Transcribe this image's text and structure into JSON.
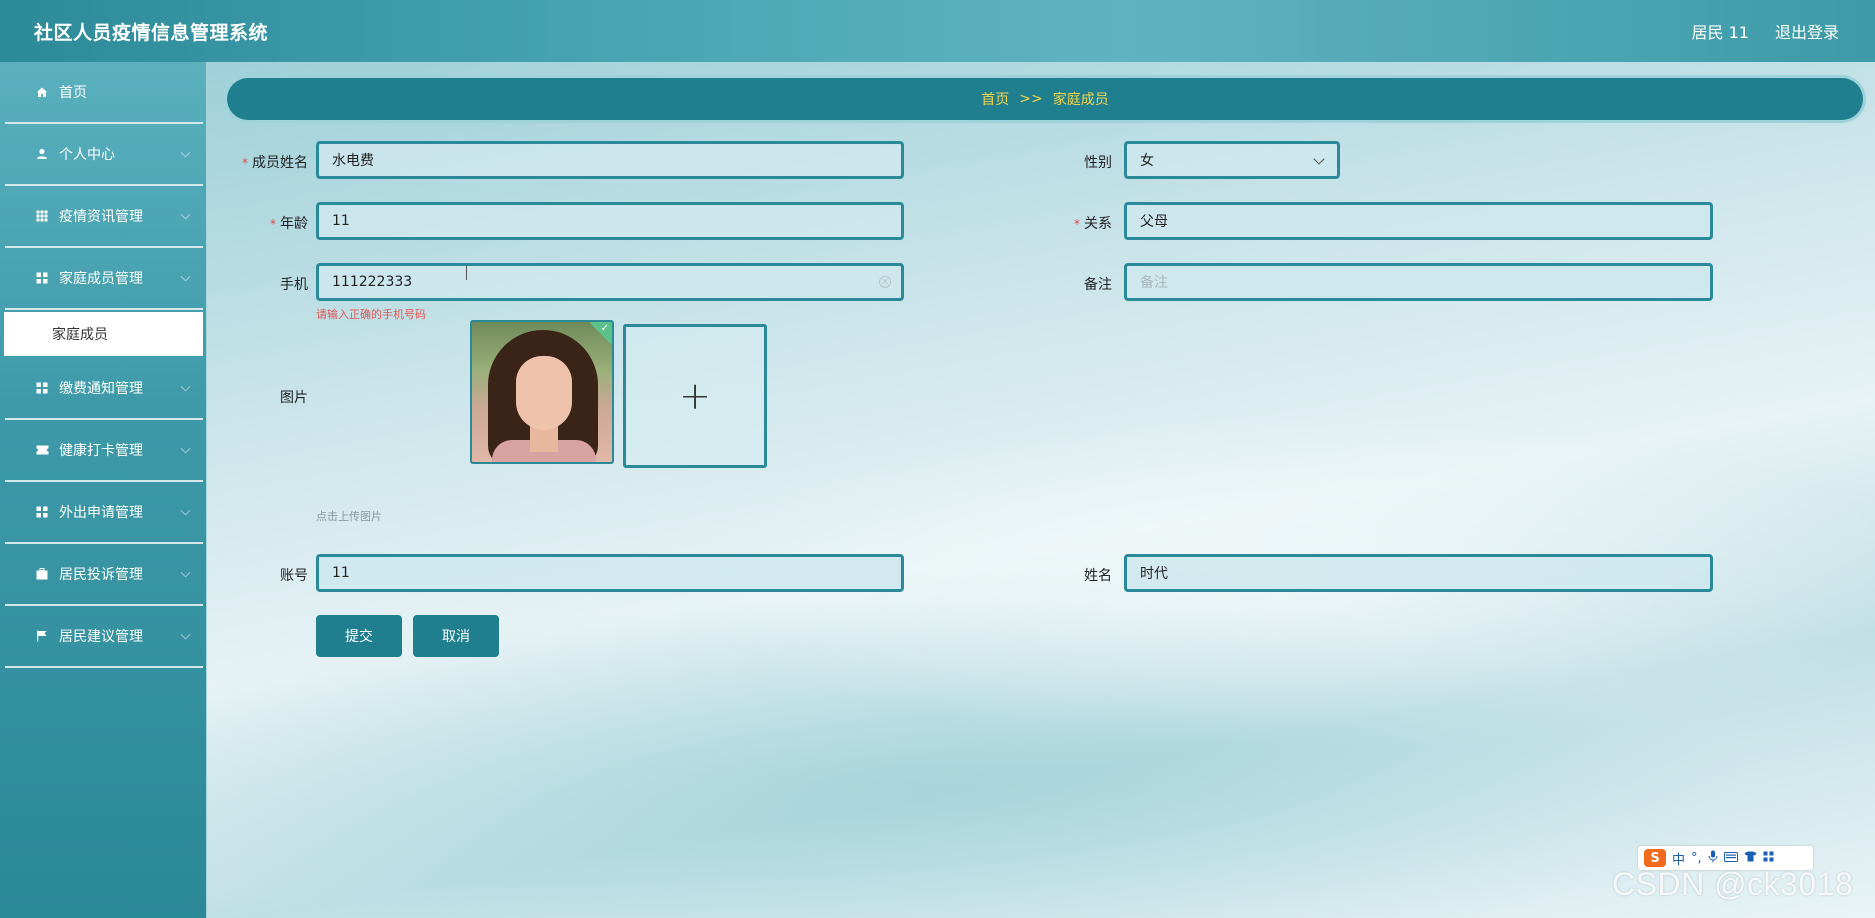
{
  "app": {
    "title": "社区人员疫情信息管理系统",
    "user_label": "居民 11",
    "logout_label": "退出登录"
  },
  "sidebar": {
    "items": [
      {
        "label": "首页",
        "icon": "home-icon"
      },
      {
        "label": "个人中心",
        "icon": "user-icon"
      },
      {
        "label": "疫情资讯管理",
        "icon": "grid-icon"
      },
      {
        "label": "家庭成员管理",
        "icon": "apps-icon"
      },
      {
        "label": "家庭成员",
        "icon": ""
      },
      {
        "label": "缴费通知管理",
        "icon": "apps-icon"
      },
      {
        "label": "健康打卡管理",
        "icon": "ticket-icon"
      },
      {
        "label": "外出申请管理",
        "icon": "apps-icon"
      },
      {
        "label": "居民投诉管理",
        "icon": "briefcase-icon"
      },
      {
        "label": "居民建议管理",
        "icon": "flag-icon"
      }
    ]
  },
  "breadcrumb": {
    "home": "首页",
    "separator": ">>",
    "current": "家庭成员"
  },
  "form": {
    "member_name_label": "成员姓名",
    "member_name_value": "水电费",
    "gender_label": "性别",
    "gender_value": "女",
    "age_label": "年龄",
    "age_value": "11",
    "relation_label": "关系",
    "relation_value": "父母",
    "phone_label": "手机",
    "phone_value": "111222333",
    "phone_error": "请输入正确的手机号码",
    "remark_label": "备注",
    "remark_placeholder": "备注",
    "image_label": "图片",
    "upload_plus": "+",
    "upload_hint": "点击上传图片",
    "account_label": "账号",
    "account_value": "11",
    "name_label": "姓名",
    "name_value": "时代",
    "required_mark": "*",
    "submit_label": "提交",
    "cancel_label": "取消"
  },
  "ime": {
    "s_label": "S",
    "mode": "中",
    "punct": "°,"
  },
  "watermark": "CSDN @ck3018",
  "colors": {
    "accent": "#1f7f8f",
    "breadcrumb_text": "#f5d548",
    "error": "#e25555"
  }
}
